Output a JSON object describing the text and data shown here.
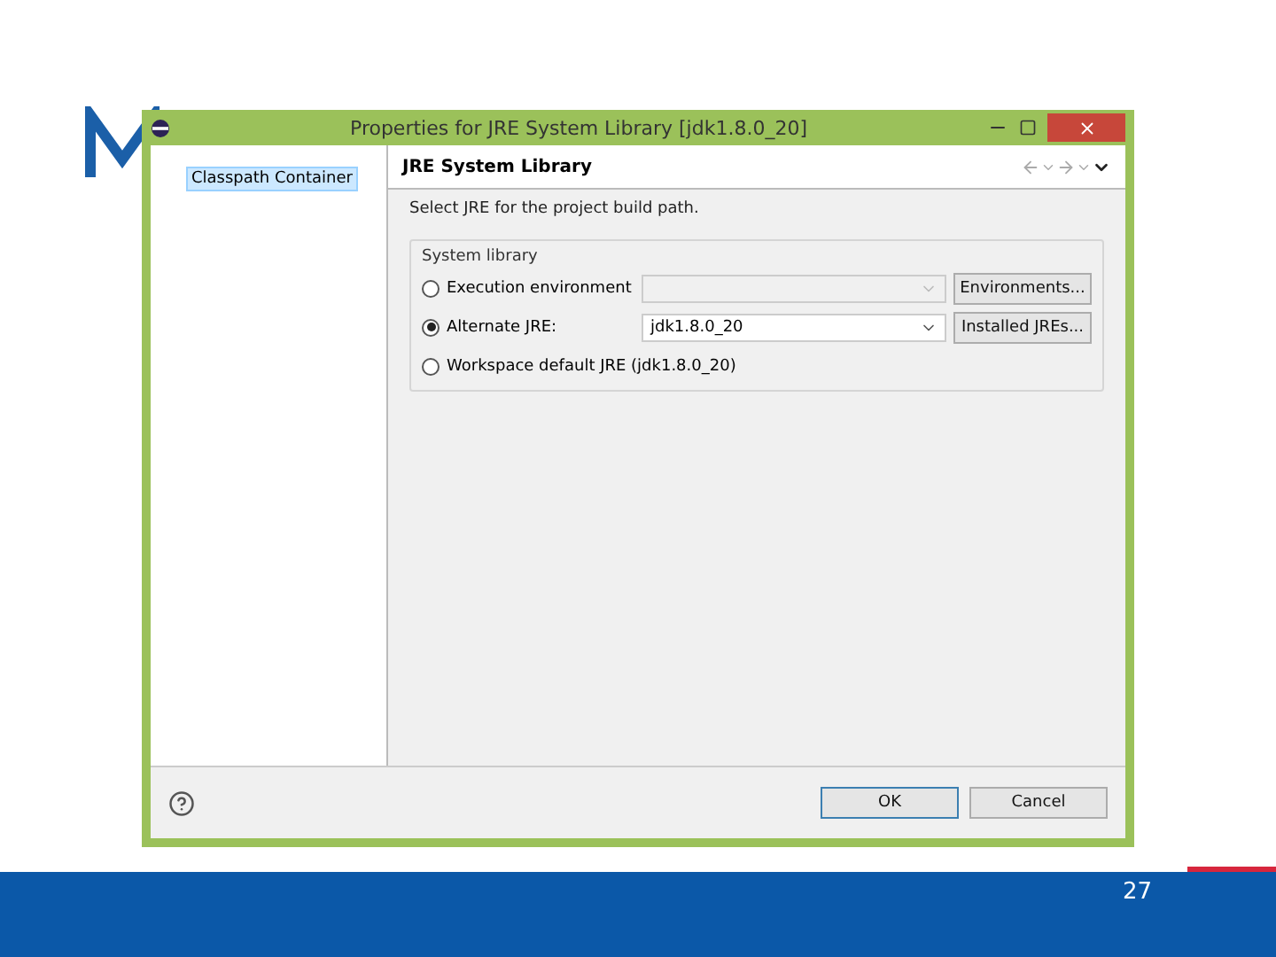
{
  "window": {
    "title": "Properties for JRE System Library [jdk1.8.0_20]"
  },
  "tree": {
    "items": [
      {
        "label": "Classpath Container",
        "selected": true
      }
    ]
  },
  "page": {
    "title": "JRE System Library",
    "description": "Select JRE for the project build path.",
    "group": {
      "title": "System library",
      "options": [
        {
          "label": "Execution environment",
          "selected": false,
          "combo": {
            "disabled": true
          },
          "button": "Environments..."
        },
        {
          "label": "Alternate JRE:",
          "selected": true,
          "combo": {
            "value": "jdk1.8.0_20",
            "disabled": false
          },
          "button": "Installed JREs..."
        },
        {
          "label": "Workspace default JRE (jdk1.8.0_20)",
          "selected": false
        }
      ]
    }
  },
  "buttons": [
    {
      "label": "OK",
      "default": true
    },
    {
      "label": "Cancel",
      "default": false
    }
  ],
  "slide": {
    "page_number": "27"
  }
}
